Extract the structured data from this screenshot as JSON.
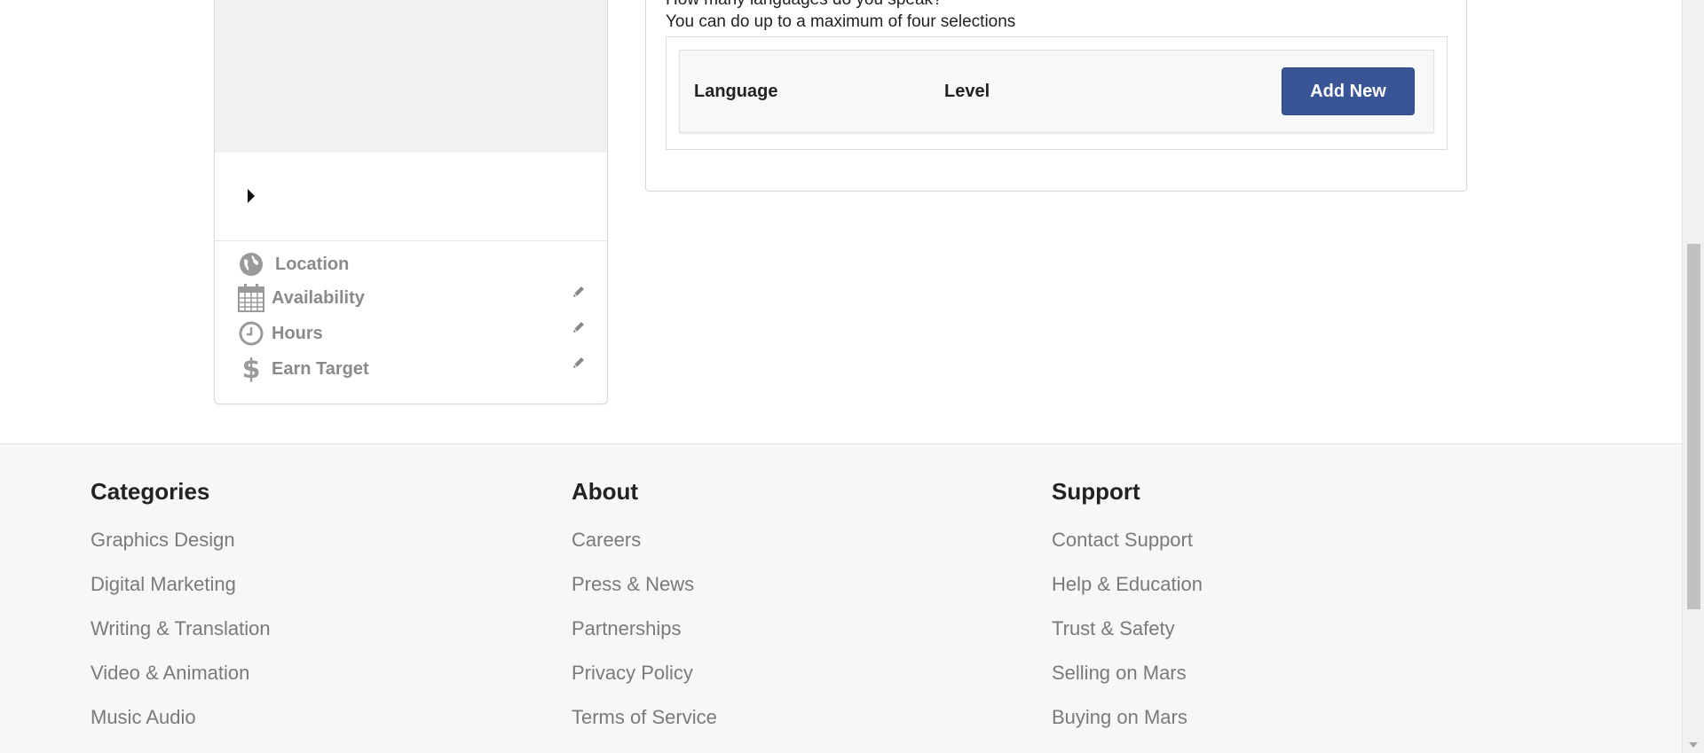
{
  "profile": {
    "info": [
      {
        "icon": "globe-icon",
        "label": "Location",
        "editable": false
      },
      {
        "icon": "calendar-icon",
        "label": "Availability",
        "editable": true
      },
      {
        "icon": "clock-icon",
        "label": "Hours",
        "editable": true
      },
      {
        "icon": "dollar-icon",
        "label": "Earn Target",
        "editable": true
      }
    ]
  },
  "languages": {
    "question": "How many languages do you speak?",
    "hint": "You can do up to a maximum of four selections",
    "columns": [
      "Language",
      "Level"
    ],
    "add_button": "Add New"
  },
  "footer": {
    "columns": [
      {
        "heading": "Categories",
        "links": [
          "Graphics Design",
          "Digital Marketing",
          "Writing & Translation",
          "Video & Animation",
          "Music Audio"
        ]
      },
      {
        "heading": "About",
        "links": [
          "Careers",
          "Press & News",
          "Partnerships",
          "Privacy Policy",
          "Terms of Service"
        ]
      },
      {
        "heading": "Support",
        "links": [
          "Contact Support",
          "Help & Education",
          "Trust & Safety",
          "Selling on Mars",
          "Buying on Mars"
        ]
      }
    ]
  },
  "colors": {
    "accent": "#3a5596",
    "muted_text": "#8a8a8a",
    "footer_bg": "#f7f7f7"
  }
}
